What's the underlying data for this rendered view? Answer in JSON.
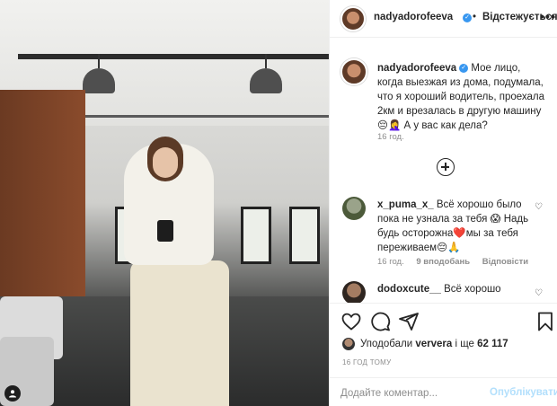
{
  "header": {
    "username": "nadyadorofeeva",
    "separator": "•",
    "follow_status": "Відстежується",
    "more": "•••"
  },
  "caption": {
    "username": "nadyadorofeeva",
    "text": "Мое лицо, когда выезжая из дома, подумала, что я хороший водитель, проехала 2км и врезалась в другую машину😔🤦‍♀️ А у вас как дела?",
    "time": "16 год."
  },
  "comments": [
    {
      "username": "x_puma_x_",
      "text": "Всё хорошо было пока не узнала за тебя 😱 Надь будь осторожна❤️мы за тебя переживаем😔🙏",
      "time": "16 год.",
      "likes": "9 вподобань",
      "reply": "Відповісти"
    },
    {
      "username": "dodoxcute__",
      "text": "Всё хорошо"
    }
  ],
  "actions": {
    "like": "heart-icon",
    "comment": "comment-icon",
    "share": "share-icon",
    "save": "bookmark-icon"
  },
  "likes": {
    "prefix": "Уподобали",
    "user": "ververa",
    "middle": "і ще",
    "count": "62 117"
  },
  "timestamp": "16 год тому",
  "comment_box": {
    "placeholder": "Додайте коментар...",
    "submit_label": "Опублікувати"
  },
  "colors": {
    "accent": "#3897f0",
    "publish_disabled": "#b2dffc",
    "secondary_text": "#8e8e8e"
  }
}
